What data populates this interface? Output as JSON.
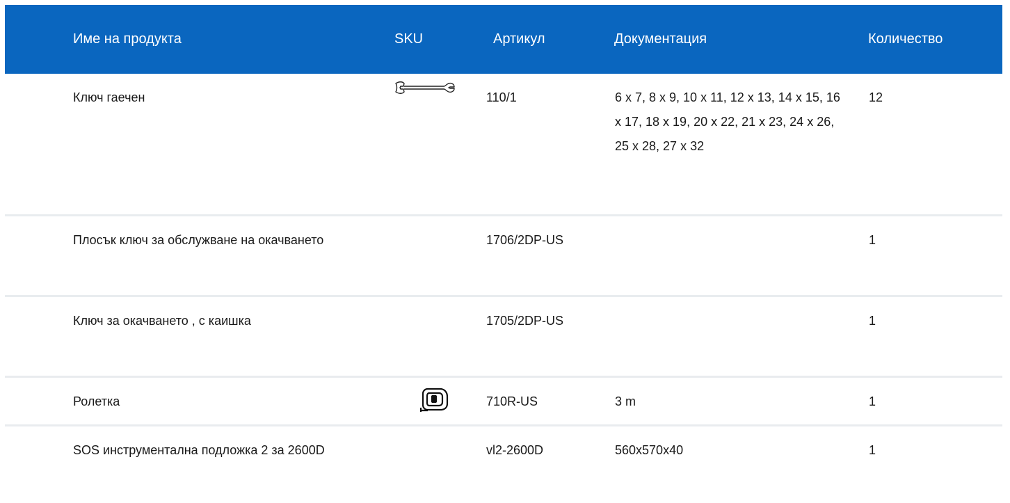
{
  "table": {
    "headers": {
      "name": "Име на продукта",
      "sku": "SKU",
      "article": "Артикул",
      "documentation": "Документация",
      "quantity": "Количество"
    },
    "rows": [
      {
        "name": "Ключ гаечен",
        "sku_icon": "wrench-icon",
        "article": "110/1",
        "documentation": "6 x 7, 8 x 9, 10 x 11, 12 x 13, 14 x 15, 16 x 17, 18 x 19, 20 x 22, 21 x 23, 24 x 26, 25 x 28, 27 x 32",
        "quantity": "12"
      },
      {
        "name": "Плосък ключ за обслужване на окачването",
        "sku_icon": "",
        "article": "1706/2DP-US",
        "documentation": "",
        "quantity": "1"
      },
      {
        "name": "Ключ за окачването , с каишка",
        "sku_icon": "",
        "article": "1705/2DP-US",
        "documentation": "",
        "quantity": "1"
      },
      {
        "name": "Ролетка",
        "sku_icon": "tape-measure-icon",
        "article": "710R-US",
        "documentation": "3 m",
        "quantity": "1"
      },
      {
        "name": "SOS инструментална подложка 2 за 2600D",
        "sku_icon": "",
        "article": "vl2-2600D",
        "documentation": "560x570x40",
        "quantity": "1"
      }
    ]
  },
  "colors": {
    "header_bg": "#0a66bf",
    "header_text": "#ffffff",
    "row_divider": "#e9ecef",
    "body_text": "#1a1a1a"
  }
}
